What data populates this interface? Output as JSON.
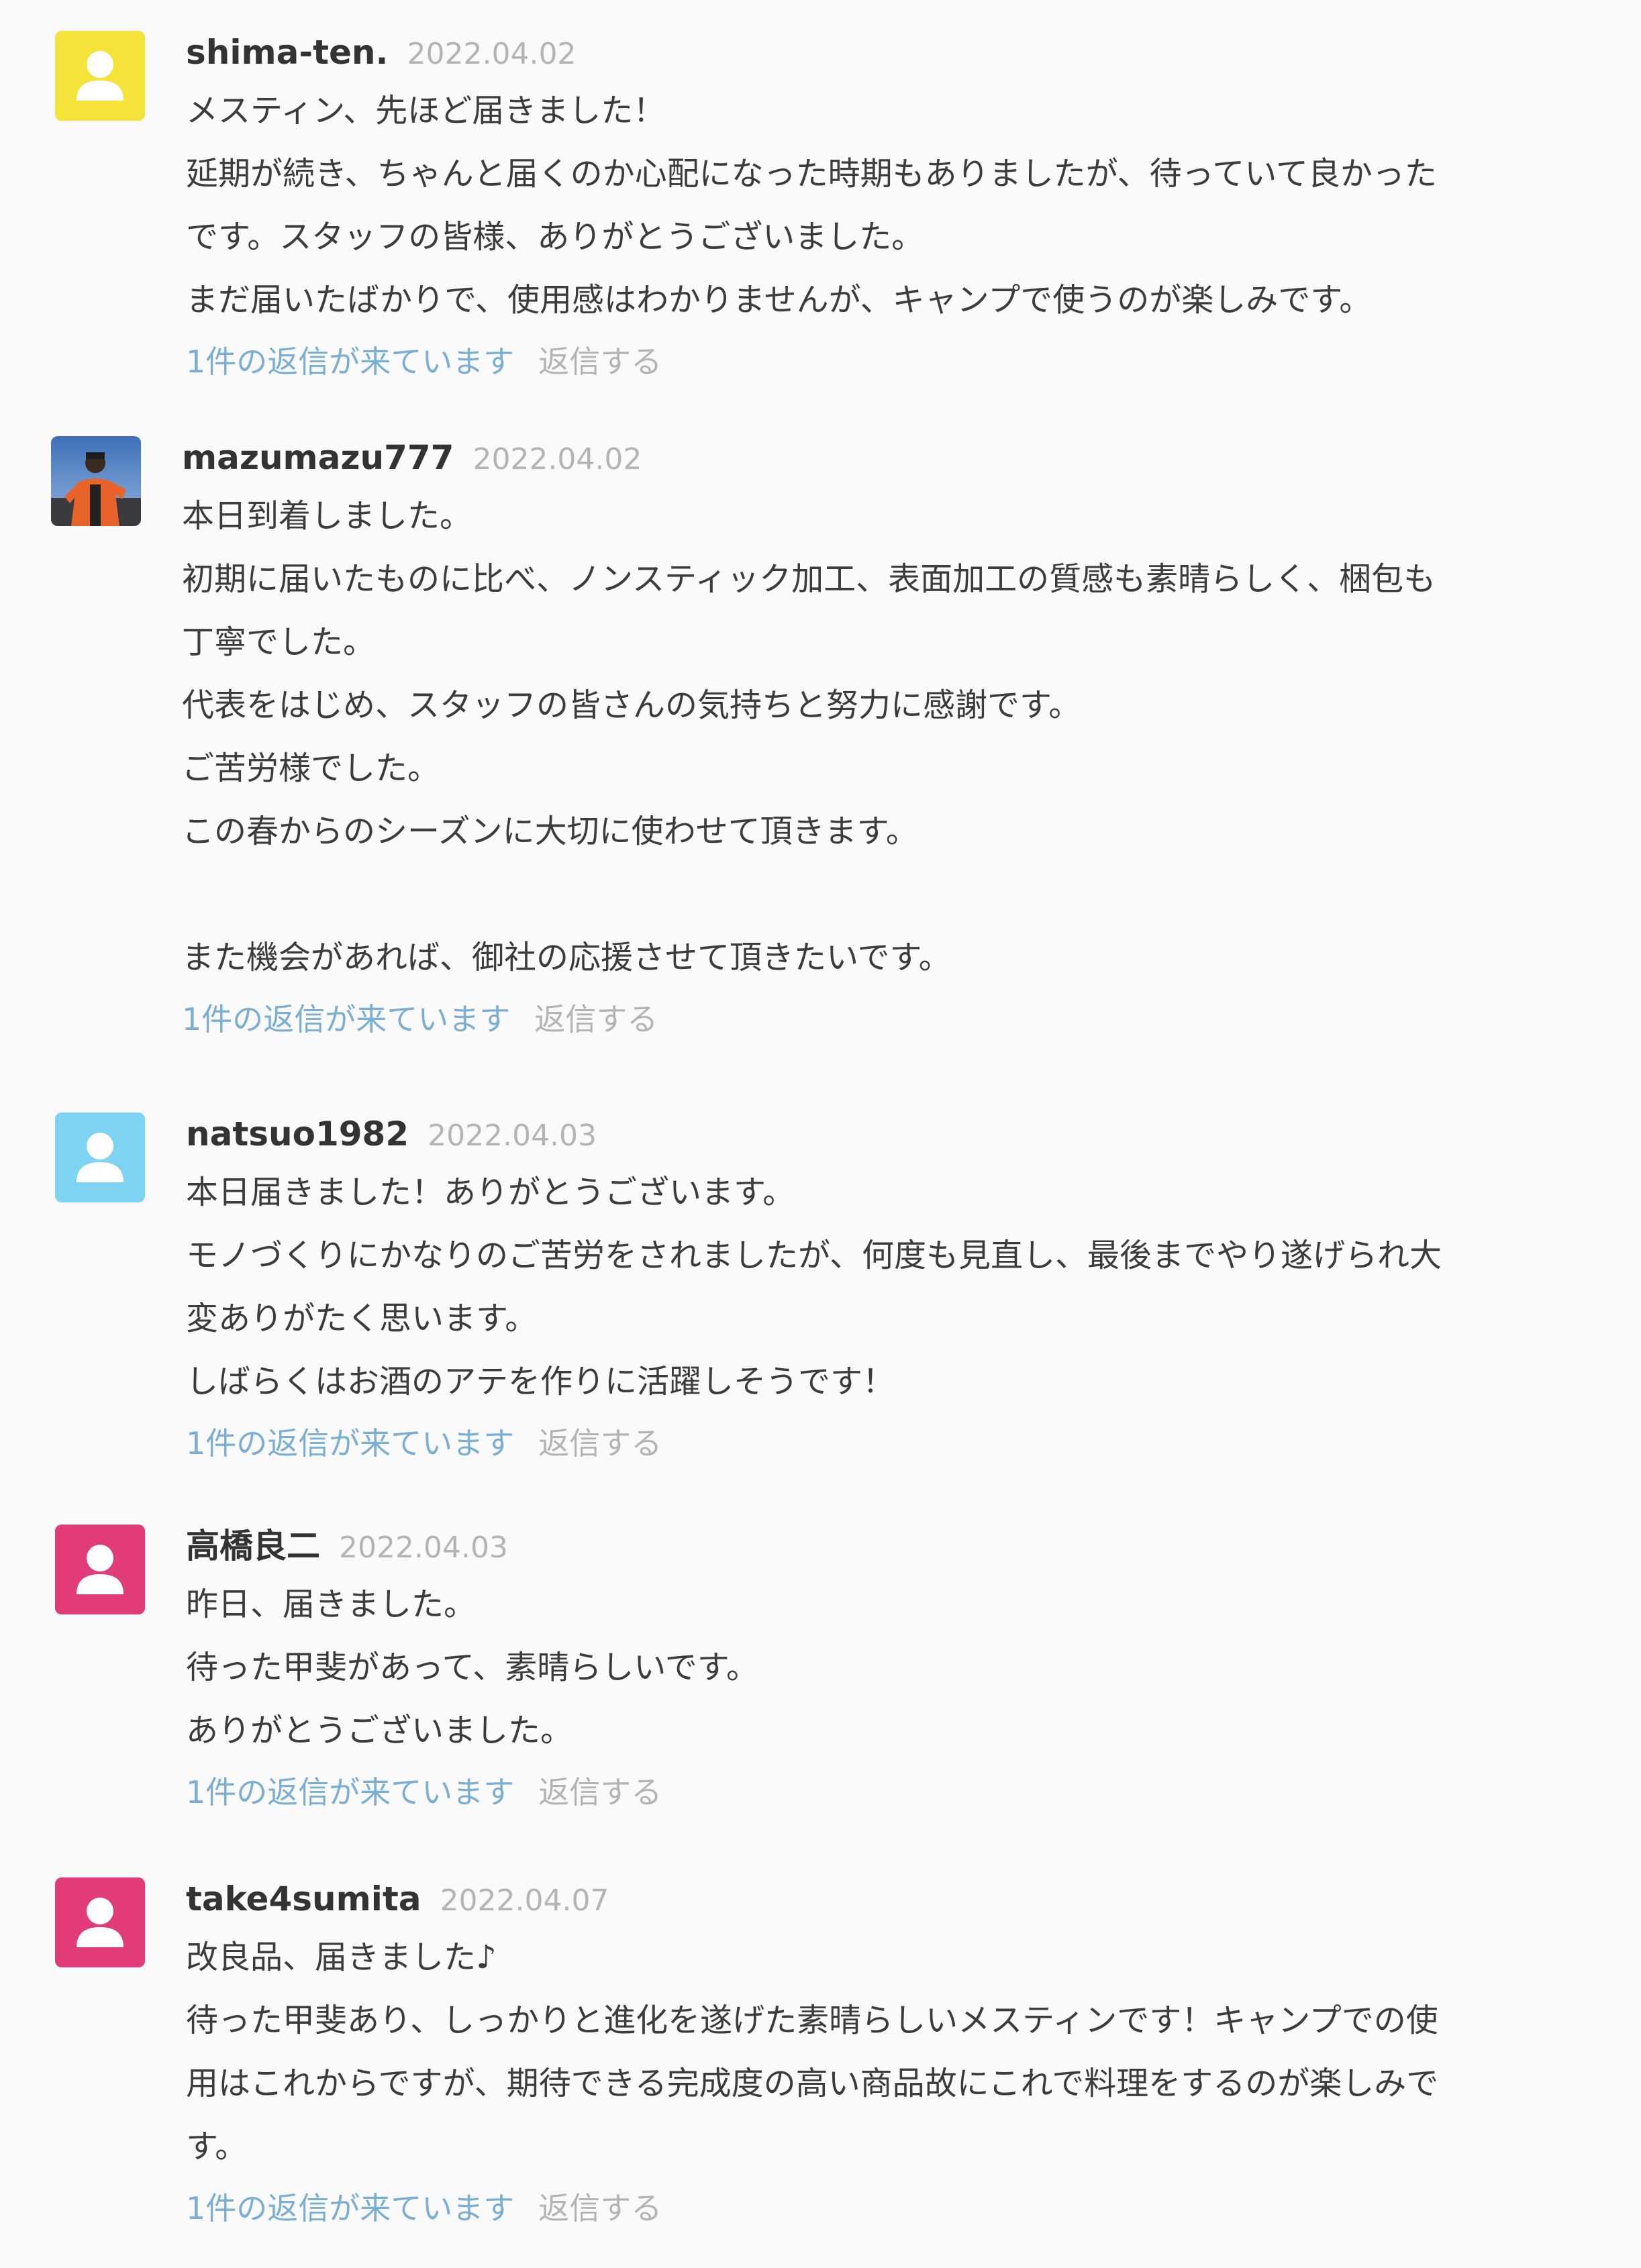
{
  "comments": [
    {
      "username": "shima-ten.",
      "date": "2022.04.02",
      "avatar_color": "#f5e33a",
      "lines": [
        "メスティン、先ほど届きました！",
        "延期が続き、ちゃんと届くのか心配になった時期もありましたが、待っていて良かった",
        "です。スタッフの皆様、ありがとうございました。",
        "まだ届いたばかりで、使用感はわかりませんが、キャンプで使うのが楽しみです。"
      ],
      "reply_count_label": "1件の返信が来ています",
      "reply_label": "返信する"
    },
    {
      "username": "mazumazu777",
      "date": "2022.04.02",
      "avatar_color": "photo",
      "lines": [
        "本日到着しました。",
        "初期に届いたものに比べ、ノンスティック加工、表面加工の質感も素晴らしく、梱包も",
        "丁寧でした。",
        "代表をはじめ、スタッフの皆さんの気持ちと努力に感謝です。",
        "ご苦労様でした。",
        "この春からのシーズンに大切に使わせて頂きます。",
        "",
        "また機会があれば、御社の応援させて頂きたいです。"
      ],
      "reply_count_label": "1件の返信が来ています",
      "reply_label": "返信する"
    },
    {
      "username": "natsuo1982",
      "date": "2022.04.03",
      "avatar_color": "#7fd3f2",
      "lines": [
        "本日届きました！ありがとうございます。",
        "モノづくりにかなりのご苦労をされましたが、何度も見直し、最後までやり遂げられ大",
        "変ありがたく思います。",
        "しばらくはお酒のアテを作りに活躍しそうです！"
      ],
      "reply_count_label": "1件の返信が来ています",
      "reply_label": "返信する"
    },
    {
      "username": "高橋良二",
      "date": "2022.04.03",
      "avatar_color": "#e13b7a",
      "lines": [
        "昨日、届きました。",
        "待った甲斐があって、素晴らしいです。",
        "ありがとうございました。"
      ],
      "reply_count_label": "1件の返信が来ています",
      "reply_label": "返信する"
    },
    {
      "username": "take4sumita",
      "date": "2022.04.07",
      "avatar_color": "#e13b7a",
      "lines": [
        "改良品、届きました♪",
        "待った甲斐あり、しっかりと進化を遂げた素晴らしいメスティンです！キャンプでの使",
        "用はこれからですが、期待できる完成度の高い商品故にこれで料理をするのが楽しみで",
        "す。"
      ],
      "reply_count_label": "1件の返信が来ています",
      "reply_label": "返信する"
    }
  ]
}
